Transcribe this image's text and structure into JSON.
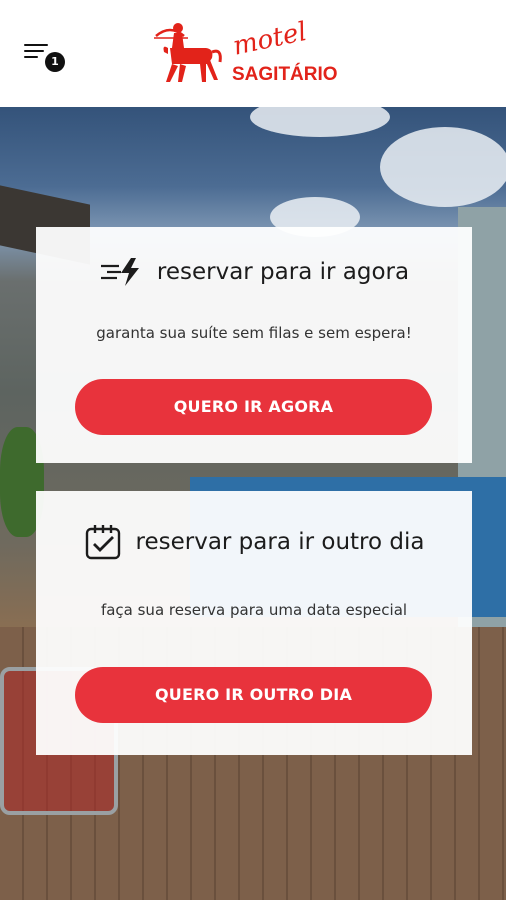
{
  "header": {
    "notification_count": "1",
    "logo_script_text": "motel",
    "logo_brand_text": "SAGITÁRIO",
    "menu_icon": "hamburger-menu-icon"
  },
  "cards": [
    {
      "icon": "lightning-speed-icon",
      "title": "reservar para ir agora",
      "subtitle": "garanta sua suíte sem filas e sem espera!",
      "button_label": "QUERO IR AGORA"
    },
    {
      "icon": "calendar-check-icon",
      "title": "reservar para ir outro dia",
      "subtitle": "faça sua reserva para uma data especial",
      "button_label": "QUERO IR OUTRO DIA"
    }
  ],
  "colors": {
    "accent": "#e8333c",
    "brand_red": "#e2231a",
    "text_dark": "#1c1c1c",
    "card_bg": "#ffffff"
  }
}
